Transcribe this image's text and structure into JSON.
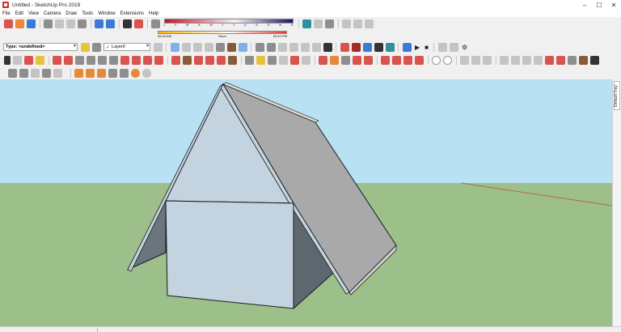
{
  "window": {
    "title": "Untitled - SketchUp Pro 2019",
    "minimize": "–",
    "maximize": "☐",
    "close": "✕"
  },
  "menu": [
    "File",
    "Edit",
    "View",
    "Camera",
    "Draw",
    "Tools",
    "Window",
    "Extensions",
    "Help"
  ],
  "shadows": {
    "months": [
      "J",
      "F",
      "M",
      "A",
      "M",
      "J",
      "J",
      "A",
      "S",
      "O",
      "N",
      "D"
    ],
    "time_start": "06:43 AM",
    "time_noon": "Noon",
    "time_end": "04:10 PM"
  },
  "entity_info": {
    "type_value": "Type: <undefined>",
    "layer_value": "Layer0",
    "layer_check": "✓"
  },
  "tray": {
    "label": "Default Tray"
  },
  "colors": {
    "sky": "#b8e1f4",
    "ground": "#9dc08b",
    "wall_light": "#c3d3df",
    "wall_dark": "#5c6770",
    "roof": "#a9a9a9",
    "edge": "#1a1a1a"
  }
}
